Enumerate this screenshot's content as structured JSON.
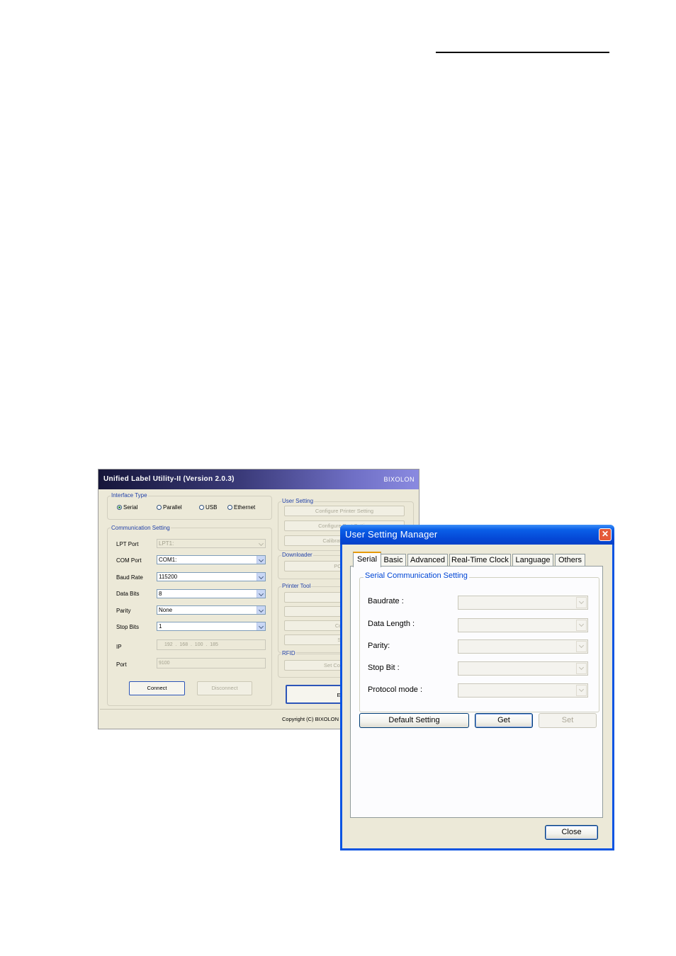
{
  "main_window": {
    "title": "Unified Label Utility-II (Version 2.0.3)",
    "brand": "BIXOLON",
    "interface_type": {
      "label": "Interface Type",
      "options": [
        "Serial",
        "Parallel",
        "USB",
        "Ethernet"
      ],
      "selected": "Serial"
    },
    "communication": {
      "label": "Communication Setting",
      "lpt_port": {
        "label": "LPT Port",
        "value": "LPT1:"
      },
      "com_port": {
        "label": "COM Port",
        "value": "COM1:"
      },
      "baud_rate": {
        "label": "Baud Rate",
        "value": "115200"
      },
      "data_bits": {
        "label": "Data Bits",
        "value": "8"
      },
      "parity": {
        "label": "Parity",
        "value": "None"
      },
      "stop_bits": {
        "label": "Stop Bits",
        "value": "1"
      },
      "ip": {
        "label": "IP",
        "value": "192  .  168  .  100  .  185"
      },
      "port": {
        "label": "Port",
        "value": "9100"
      },
      "connect": "Connect",
      "disconnect": "Disconnect"
    },
    "user_setting": {
      "label": "User Setting",
      "buttons": [
        "Configure Printer Setting",
        "Configure Port Setting",
        "Calibration Setting"
      ]
    },
    "downloader": {
      "label": "Downloader",
      "buttons": [
        "PCX File"
      ]
    },
    "printer_tool": {
      "label": "Printer Tool",
      "buttons": [
        "Se",
        "Prin",
        "Commu",
        "SLCS"
      ]
    },
    "rfid": {
      "label": "RFID",
      "button": "Set Configuration"
    },
    "exit_button": "E",
    "copyright": "Copyright (C) BIXOLON"
  },
  "dialog": {
    "title": "User Setting Manager",
    "tabs": [
      "Serial",
      "Basic",
      "Advanced",
      "Real-Time Clock",
      "Language",
      "Others"
    ],
    "active_tab": "Serial",
    "group_label": "Serial Communication Setting",
    "fields": {
      "baudrate": "Baudrate :",
      "data_length": "Data Length :",
      "parity": "Parity:",
      "stop_bit": "Stop Bit :",
      "protocol_mode": "Protocol mode :"
    },
    "buttons": {
      "default": "Default Setting",
      "get": "Get",
      "set": "Set",
      "close": "Close"
    }
  }
}
